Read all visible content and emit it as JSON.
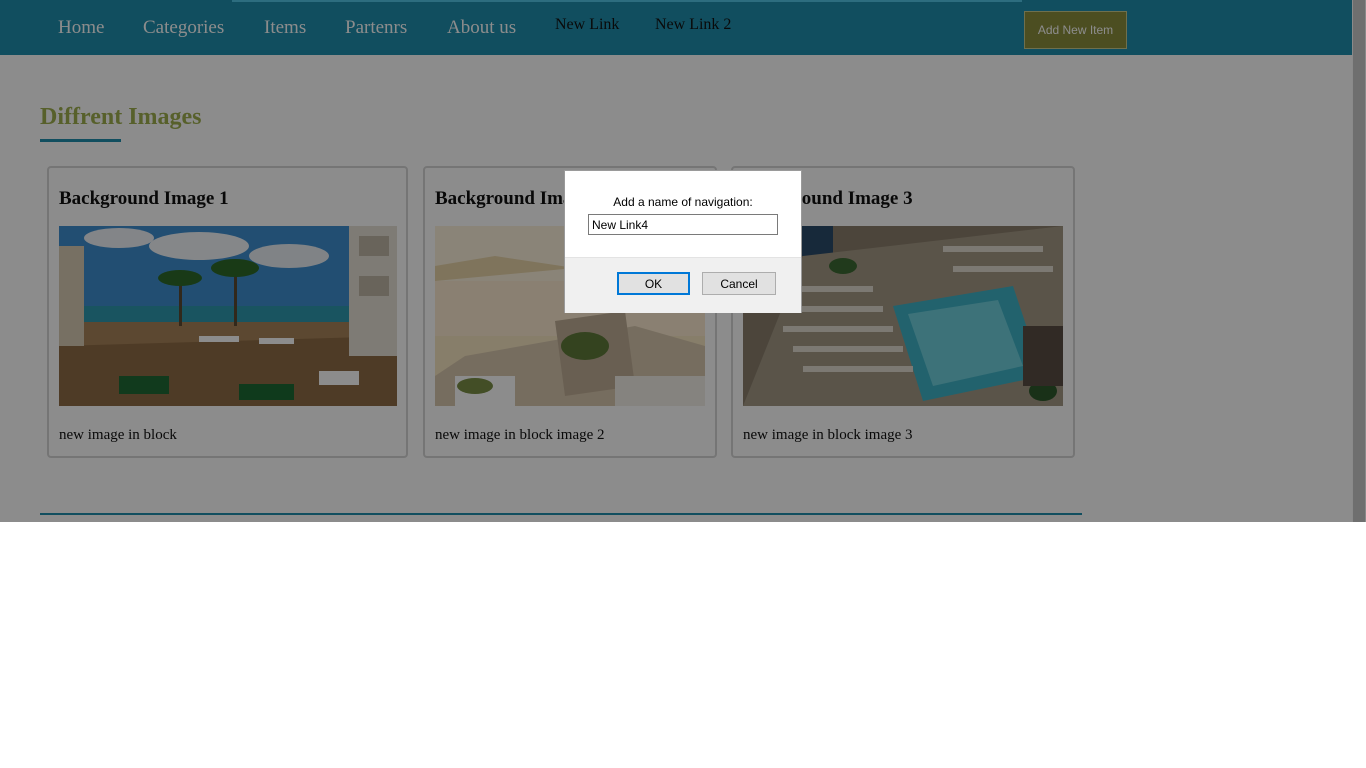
{
  "nav": {
    "links": [
      "Home",
      "Categories",
      "Items",
      "Partenrs",
      "About us"
    ],
    "extra_links": [
      "New Link",
      "New Link 2"
    ],
    "add_button": "Add New Item"
  },
  "section": {
    "title": "Diffrent Images"
  },
  "cards": [
    {
      "title": "Background Image 1",
      "caption": "new image in block"
    },
    {
      "title": "Background Image 2",
      "caption": "new image in block image 2"
    },
    {
      "title": "Background Image 3",
      "caption": "new image in block image 3"
    }
  ],
  "dialog": {
    "message": "Add a name of navigation:",
    "input_value": "New Link4",
    "ok_label": "OK",
    "cancel_label": "Cancel"
  },
  "colors": {
    "nav_bg": "#1f8fad",
    "title": "#9fb04f",
    "add_button_bg": "#8b8f3d",
    "accent": "#1f8fad"
  }
}
